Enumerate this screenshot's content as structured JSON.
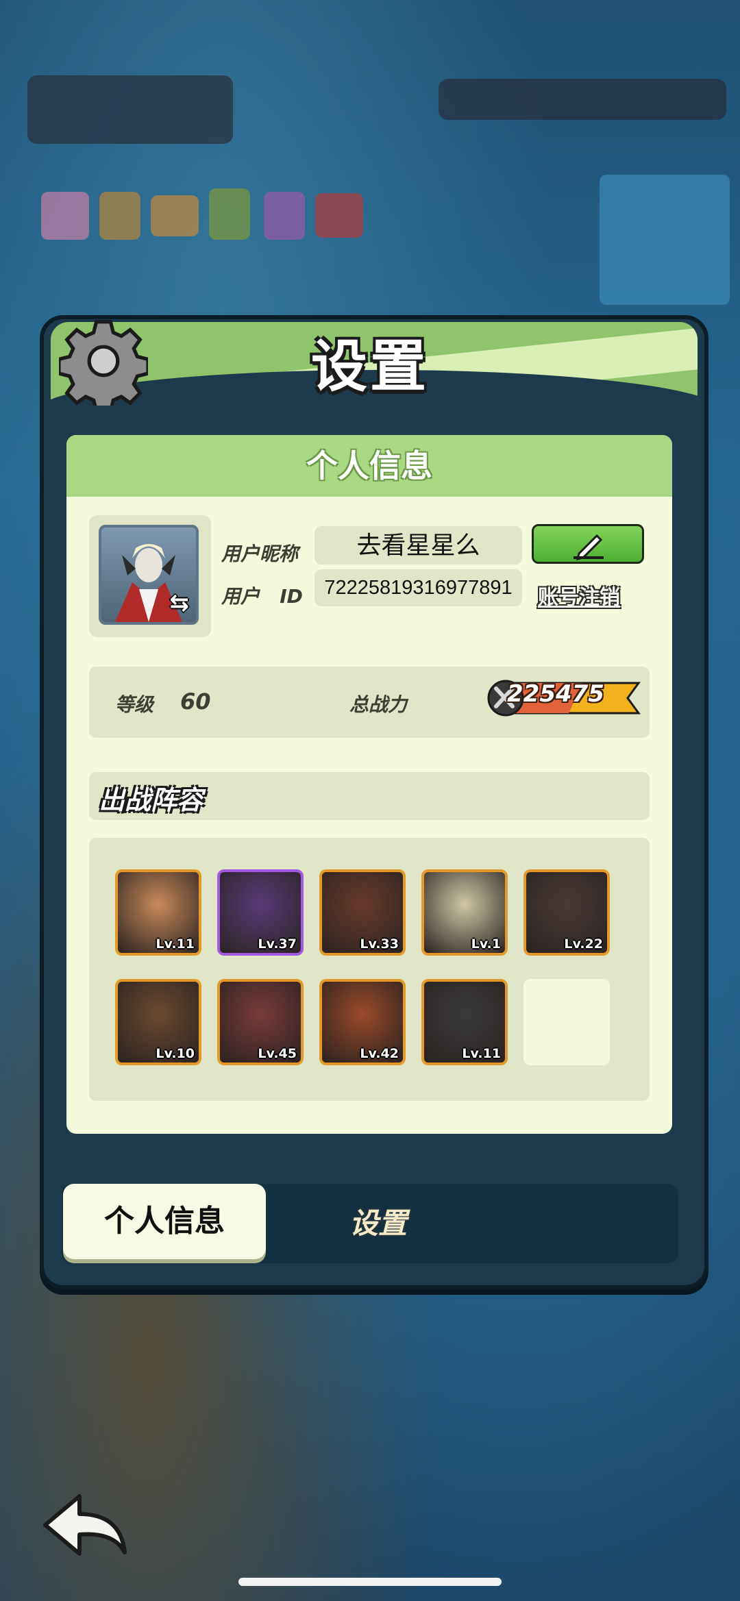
{
  "dialog": {
    "title": "设置",
    "section_header": "个人信息",
    "nickname_label": "用户昵称",
    "nickname_value": "去看星星么",
    "uid_label": "用户",
    "uid_label_suffix": "ID",
    "uid_value": "72225819316977891",
    "cancel_account": "账号注销",
    "level_label": "等级",
    "level_value": "60",
    "power_label": "总战力",
    "power_value": "225475",
    "lineup_title": "出战阵容",
    "heroes": [
      {
        "level": "Lv.11",
        "rarity": "orange",
        "color": "#c98a5a"
      },
      {
        "level": "Lv.37",
        "rarity": "purple",
        "color": "#5a3b7a"
      },
      {
        "level": "Lv.33",
        "rarity": "orange",
        "color": "#6a3b2c"
      },
      {
        "level": "Lv.1",
        "rarity": "orange",
        "color": "#cfc7a5"
      },
      {
        "level": "Lv.22",
        "rarity": "orange",
        "color": "#4a3a36"
      },
      {
        "level": "Lv.10",
        "rarity": "orange",
        "color": "#6d4a30"
      },
      {
        "level": "Lv.45",
        "rarity": "orange",
        "color": "#7a3b3b"
      },
      {
        "level": "Lv.42",
        "rarity": "orange",
        "color": "#9a4a2a"
      },
      {
        "level": "Lv.11",
        "rarity": "orange",
        "color": "#3a3a3a"
      }
    ]
  },
  "tabs": {
    "active": "个人信息",
    "other": "设置"
  },
  "icons": {
    "gear": "gear-icon",
    "edit": "pencil-icon",
    "swap": "swap-avatar-icon",
    "power": "crossed-swords-icon",
    "back": "back-arrow-icon"
  },
  "colors": {
    "header_green": "#8fc46c",
    "panel_bg": "#f4fbdc",
    "hero_border": "#e39a2a",
    "hero_border_epic": "#a35ae0"
  }
}
